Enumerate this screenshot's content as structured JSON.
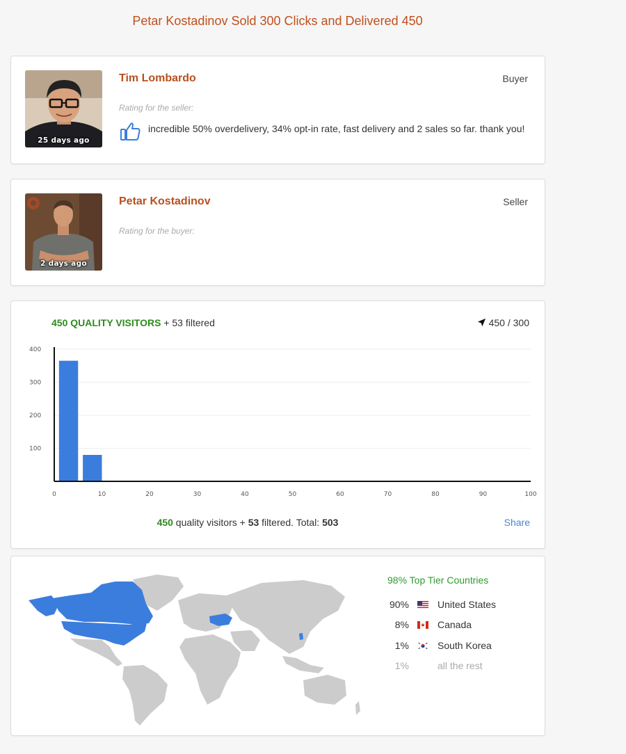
{
  "headline": "Petar Kostadinov Sold 300 Clicks and Delivered 450",
  "reviews": [
    {
      "name": "Tim Lombardo",
      "role": "Buyer",
      "time_ago": "25 days ago",
      "rating_label": "Rating for the seller:",
      "rating_icon": "thumbs-up-icon",
      "comment": "incredible 50% overdelivery, 34% opt-in rate, fast delivery and 2 sales so far. thank you!"
    },
    {
      "name": "Petar Kostadinov",
      "role": "Seller",
      "time_ago": "2 days ago",
      "rating_label": "Rating for the buyer:"
    }
  ],
  "visitors": {
    "quality_heading": "450 QUALITY VISITORS",
    "filtered_heading": "+ 53 filtered",
    "delivered_ratio": "450 / 300",
    "ratio_icon": "navigation-arrow-icon",
    "footer": {
      "quality_count": "450",
      "quality_text": " quality visitors + ",
      "filtered_count": "53",
      "filtered_text": " filtered. Total: ",
      "total": "503"
    },
    "share_label": "Share"
  },
  "chart_data": {
    "type": "bar",
    "xlim": [
      0,
      100
    ],
    "ylim": [
      0,
      400
    ],
    "x_ticks": [
      "0",
      "10",
      "20",
      "30",
      "40",
      "50",
      "60",
      "70",
      "80",
      "90",
      "100"
    ],
    "y_ticks": [
      "400",
      "300",
      "200",
      "100"
    ],
    "bars": [
      {
        "x_start": 1,
        "x_end": 5,
        "value": 365
      },
      {
        "x_start": 6,
        "x_end": 10,
        "value": 80
      }
    ],
    "bar_color": "#3b7ddd",
    "grid": true
  },
  "geo": {
    "title": "98% Top Tier Countries",
    "highlight_color": "#3b7ddd",
    "base_color": "#cccccc",
    "countries": [
      {
        "pct": "90%",
        "name": "United States",
        "flag": "us-flag-icon"
      },
      {
        "pct": "8%",
        "name": "Canada",
        "flag": "ca-flag-icon"
      },
      {
        "pct": "1%",
        "name": "South Korea",
        "flag": "kr-flag-icon"
      },
      {
        "pct": "1%",
        "name": "all the rest"
      }
    ]
  }
}
